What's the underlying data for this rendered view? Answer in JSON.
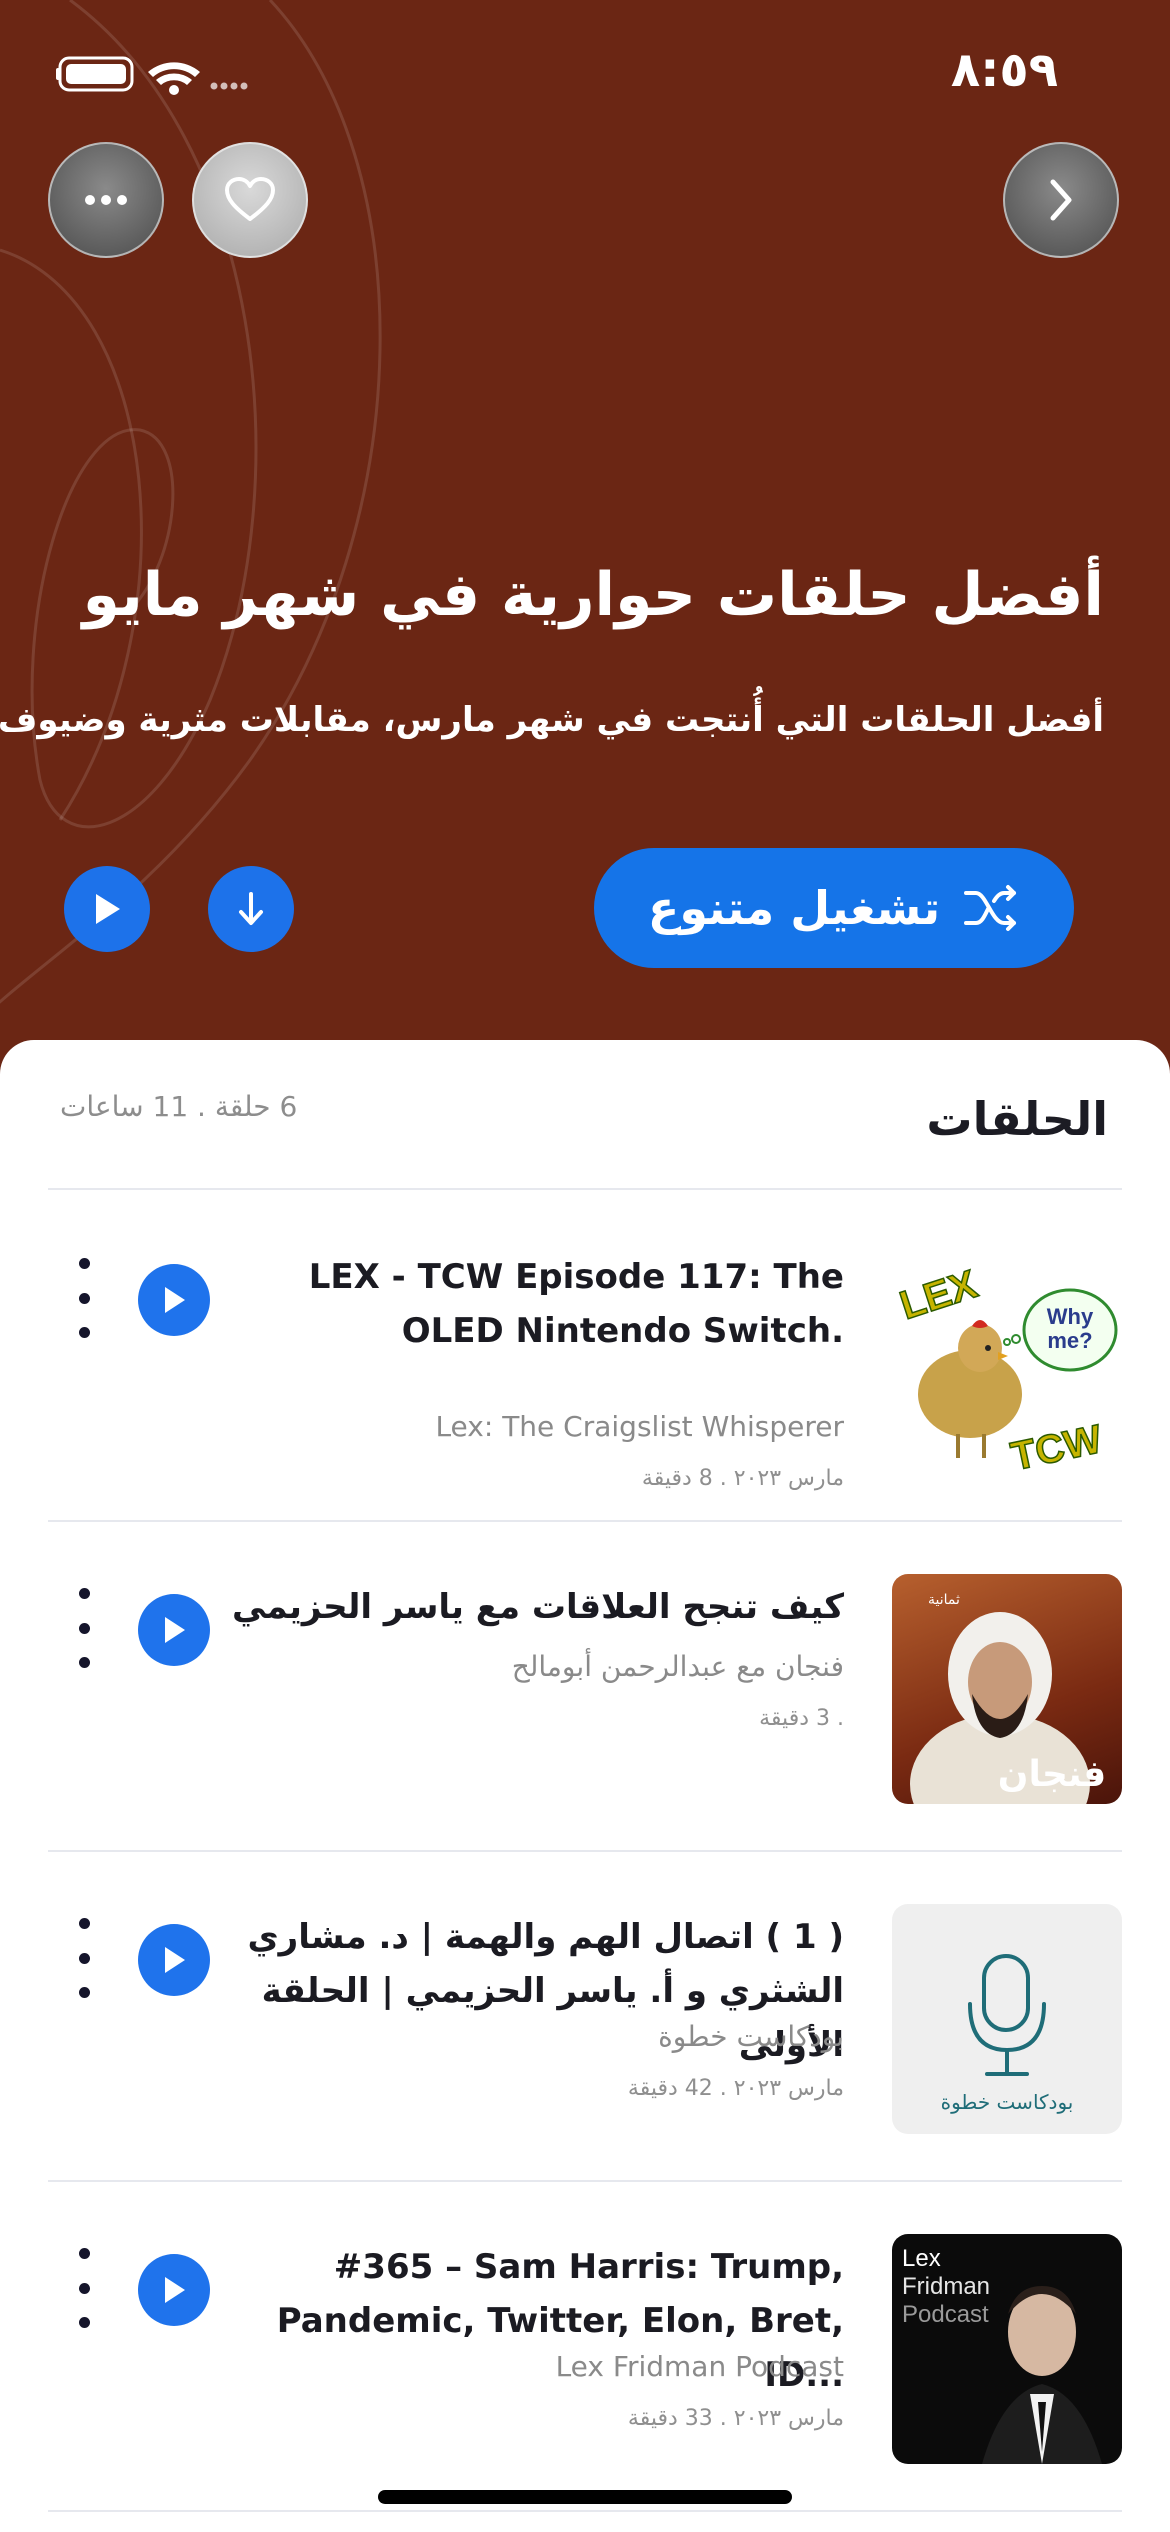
{
  "status_bar": {
    "time": "٨:٥٩"
  },
  "hero": {
    "title": "أفضل حلقات حوارية في شهر مايو",
    "subtitle": "أفضل الحلقات التي أُنتجت في شهر مارس، مقابلات مثرية وضيوف مميزين",
    "shuffle_label": "تشغيل متنوع",
    "background_color": "#6b2614",
    "accent_color": "#1574e8"
  },
  "episodes_section": {
    "title": "الحلقات",
    "meta": "6 حلقة . 11 ساعات"
  },
  "episodes": [
    {
      "title": "LEX - TCW Episode 117: The OLED Nintendo Switch.",
      "show": "Lex: The Craigslist Whisperer",
      "date": "مارس ٢٠٢٣ . 8 دقيقة",
      "thumb_text_1": "LEX",
      "thumb_text_2": "Why me?",
      "thumb_text_3": "TCW"
    },
    {
      "title": "كيف تنجح العلاقات مع ياسر الحزيمي",
      "show": "فنجان مع عبدالرحمن أبومالح",
      "date": ". 3 دقيقة",
      "thumb_text_1": "ثمانية",
      "thumb_text_2": "فنجان"
    },
    {
      "title": "( 1 ) اتصال الهم والهمة | د. مشاري الشثري و أ. ياسر الحزيمي | الحلقة الأولى",
      "show": "بودكاست خطوة",
      "date": "مارس ٢٠٢٣ . 42 دقيقة",
      "thumb_text_1": "بودكاست خطوة"
    },
    {
      "title": "#365 – Sam Harris: Trump, Pandemic, Twitter, Elon, Bret, ID...",
      "show": "Lex Fridman Podcast",
      "date": "مارس ٢٠٢٣ . 33 دقيقة",
      "thumb_text_1": "Lex",
      "thumb_text_2": "Fridman",
      "thumb_text_3": "Podcast"
    }
  ]
}
